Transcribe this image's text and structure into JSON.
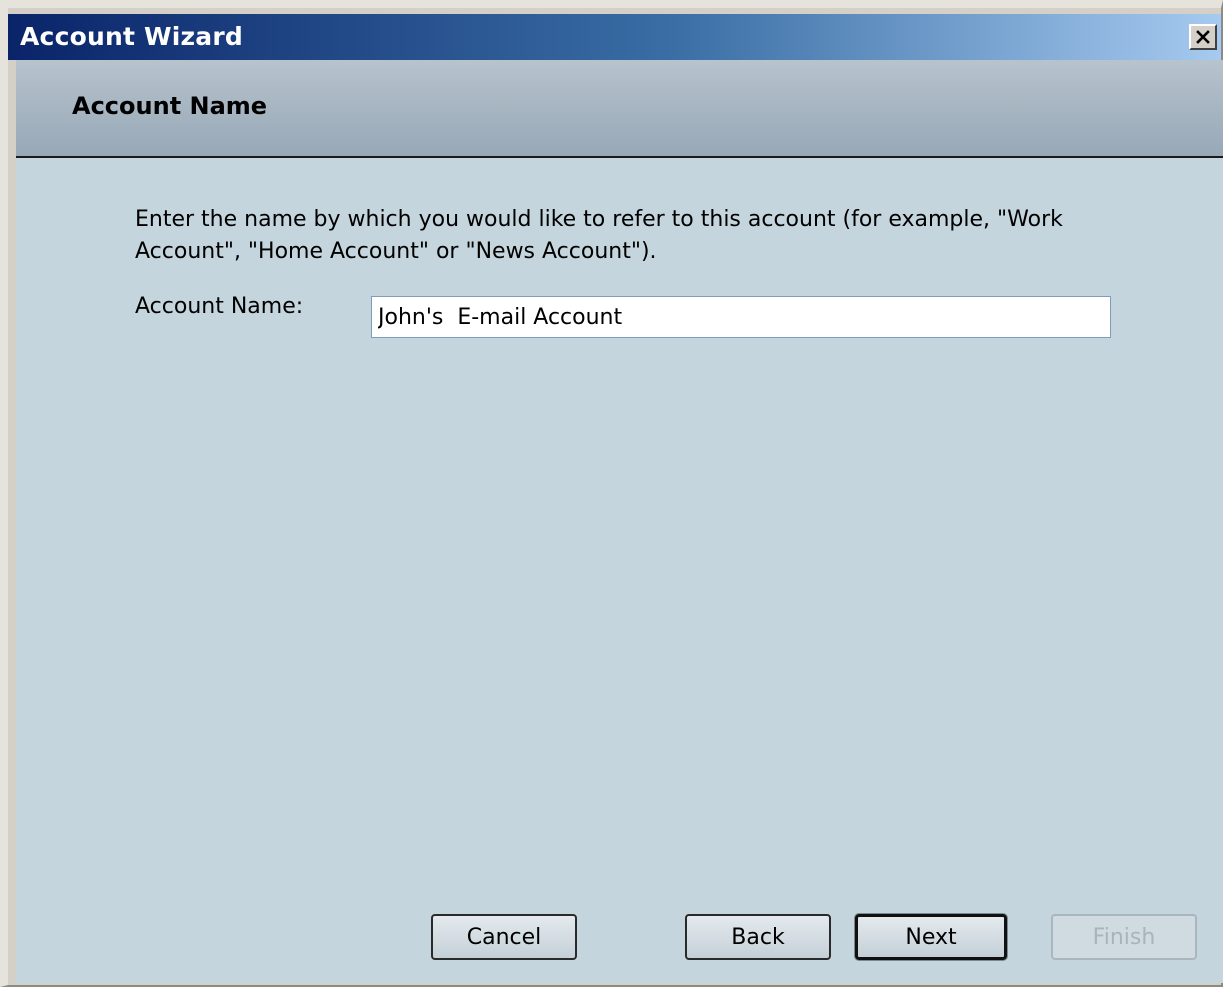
{
  "window": {
    "title": "Account Wizard",
    "close_symbol": "close-icon"
  },
  "header": {
    "page_title": "Account Name"
  },
  "main": {
    "description": "Enter the name by which you would like to refer to this account (for example, \"Work Account\", \"Home Account\" or \"News Account\").",
    "account_name_label": "Account Name:",
    "account_name_value": "John's  E-mail Account"
  },
  "buttons": {
    "cancel": "Cancel",
    "back": "Back",
    "next": "Next",
    "finish": "Finish"
  },
  "colors": {
    "titlebar_start": "#0a246a",
    "titlebar_end": "#a6caf0",
    "content_bg": "#c5d5dd",
    "header_bg": "#97a8b7"
  }
}
